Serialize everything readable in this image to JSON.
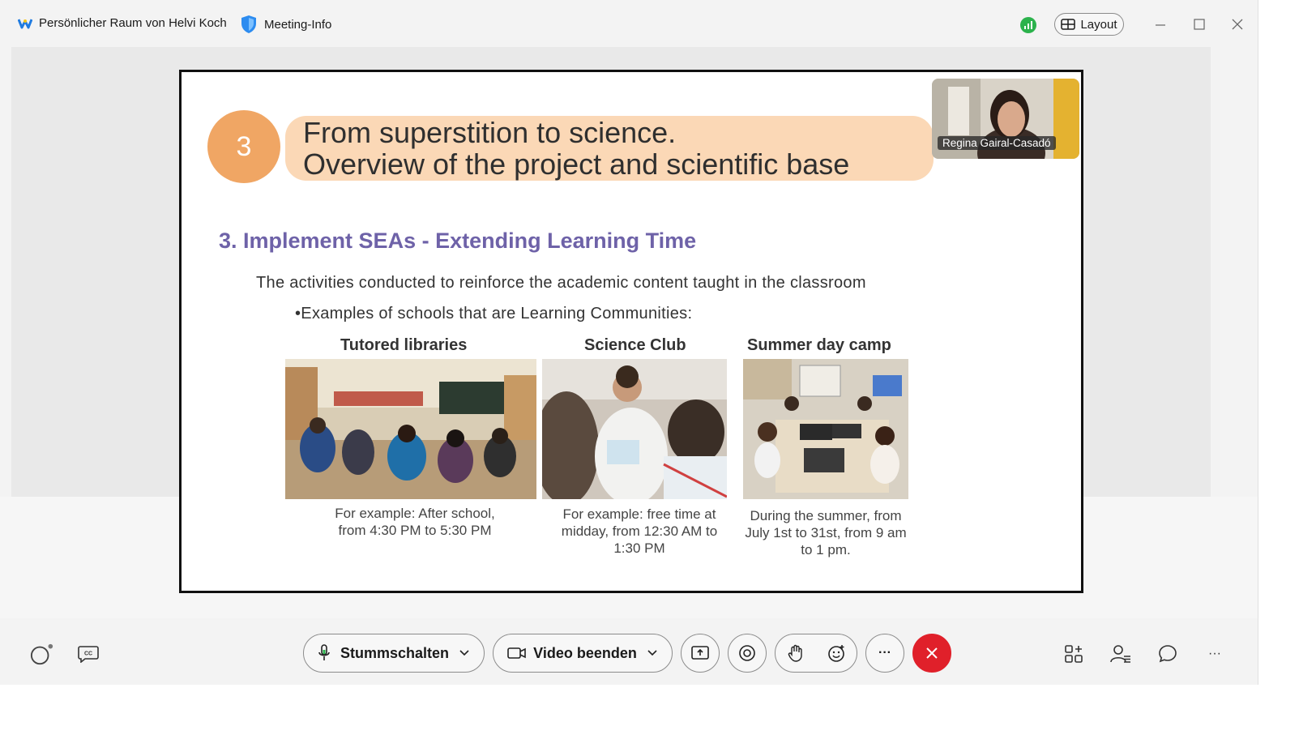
{
  "titlebar": {
    "room_title": "Persönlicher Raum von Helvi Koch",
    "meeting_info": "Meeting-Info",
    "layout_label": "Layout"
  },
  "slide": {
    "badge_number": "3",
    "title_line1": "From superstition to science.",
    "title_line2": "Overview of the project and scientific base",
    "subheading": "3. Implement SEAs - Extending Learning Time",
    "paragraph": "The activities conducted to reinforce the academic content taught in the classroom",
    "bullet": "•Examples of schools that are Learning Communities:",
    "columns": [
      {
        "title": "Tutored libraries",
        "caption_line1": "For example: After school,",
        "caption_line2": "from 4:30 PM to 5:30 PM",
        "caption_line3": ""
      },
      {
        "title": "Science Club",
        "caption_line1": "For example: free time at",
        "caption_line2": "midday, from 12:30 AM to",
        "caption_line3": "1:30 PM"
      },
      {
        "title": "Summer day camp",
        "caption_line1": "During the summer, from",
        "caption_line2": "July 1st to 31st, from 9 am",
        "caption_line3": "to 1 pm."
      }
    ]
  },
  "participant": {
    "name": "Regina Gairal-Casadó"
  },
  "controls": {
    "mute_label": "Stummschalten",
    "video_label": "Video beenden",
    "more_label": "···",
    "end_color": "#e0202a"
  },
  "colors": {
    "accent_orange": "#f0a664",
    "title_pill": "#fbd8b6",
    "subheading_purple": "#6e62a8",
    "signal_green": "#2bb24c"
  }
}
